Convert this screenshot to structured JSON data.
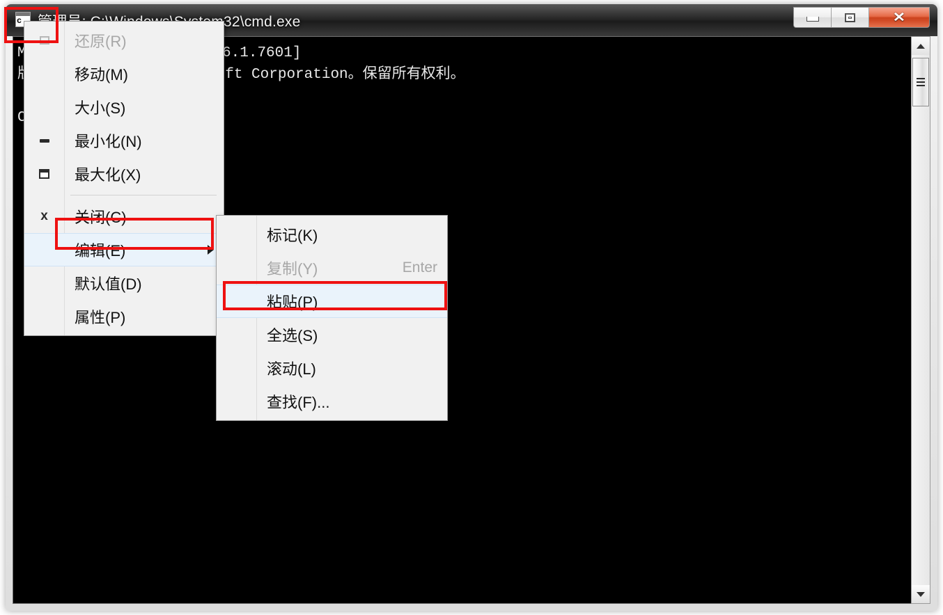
{
  "window": {
    "title": "管理员: C:\\Windows\\System32\\cmd.exe",
    "icon_letter": "c",
    "controls": {
      "minimize_label": "—",
      "maximize_label": "",
      "close_label": "✕"
    }
  },
  "console": {
    "lines": [
      "Microsoft Windows [版本 6.1.7601]",
      "版权所有 (c) 2009 Microsoft Corporation。保留所有权利。",
      "",
      "C:\\Windows\\system32>_"
    ],
    "text": "Microsoft Windows [版本 6.1.7601]\n版权所有 (c) 2009 Microsoft Corporation。保留所有权利。\n\nC:\\Windows\\system32>_",
    "background_color": "#000000",
    "text_color": "#e8e8e8"
  },
  "system_menu": {
    "items": [
      {
        "label": "还原(R)",
        "icon": "restore-icon",
        "disabled": true,
        "accel": ""
      },
      {
        "label": "移动(M)",
        "icon": "",
        "disabled": false,
        "accel": ""
      },
      {
        "label": "大小(S)",
        "icon": "",
        "disabled": false,
        "accel": ""
      },
      {
        "label": "最小化(N)",
        "icon": "minimize-icon",
        "disabled": false,
        "accel": ""
      },
      {
        "label": "最大化(X)",
        "icon": "maximize-icon",
        "disabled": false,
        "accel": ""
      },
      {
        "label": "关闭(C)",
        "icon": "close-icon",
        "disabled": false,
        "accel": ""
      },
      {
        "label": "编辑(E)",
        "icon": "",
        "disabled": false,
        "accel": "",
        "has_submenu": true,
        "highlighted": true
      },
      {
        "label": "默认值(D)",
        "icon": "",
        "disabled": false,
        "accel": ""
      },
      {
        "label": "属性(P)",
        "icon": "",
        "disabled": false,
        "accel": ""
      }
    ]
  },
  "edit_submenu": {
    "items": [
      {
        "label": "标记(K)",
        "accel": "",
        "disabled": false,
        "highlighted": false
      },
      {
        "label": "复制(Y)",
        "accel": "Enter",
        "disabled": true,
        "highlighted": false
      },
      {
        "label": "粘贴(P)",
        "accel": "",
        "disabled": false,
        "highlighted": true
      },
      {
        "label": "全选(S)",
        "accel": "",
        "disabled": false,
        "highlighted": false
      },
      {
        "label": "滚动(L)",
        "accel": "",
        "disabled": false,
        "highlighted": false
      },
      {
        "label": "查找(F)...",
        "accel": "",
        "disabled": false,
        "highlighted": false
      }
    ]
  },
  "scrollbar": {
    "up_arrow": "▲",
    "down_arrow": "▼"
  },
  "annotations": {
    "color": "#ee1111",
    "boxes": [
      {
        "name": "title-icon-highlight"
      },
      {
        "name": "edit-menu-highlight"
      },
      {
        "name": "paste-menu-highlight"
      }
    ]
  }
}
